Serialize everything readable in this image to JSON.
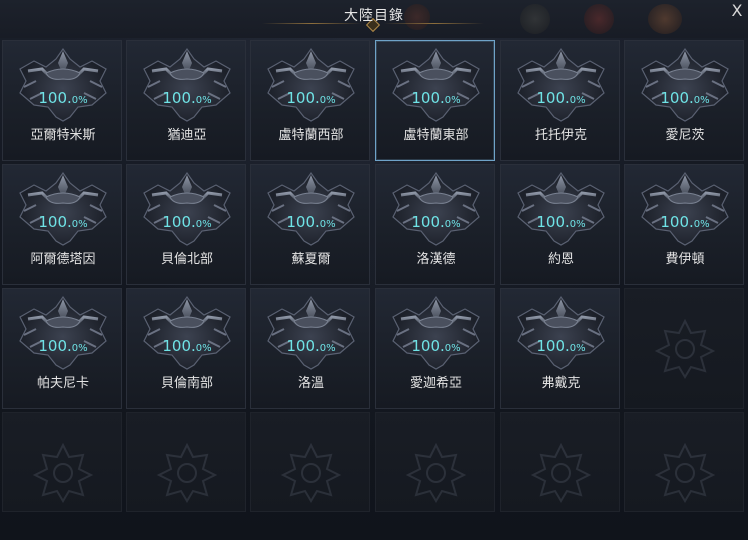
{
  "window": {
    "title": "大陸目錄",
    "close_label": "X"
  },
  "colors": {
    "accent_percent": "#6fe3e6",
    "selected_border": "#6fa3c8",
    "gold_trim": "#8c6e3c"
  },
  "continents": [
    {
      "name": "亞爾特米斯",
      "percent": "100.",
      "unit": "0%",
      "selected": false
    },
    {
      "name": "猶迪亞",
      "percent": "100.",
      "unit": "0%",
      "selected": false
    },
    {
      "name": "盧特蘭西部",
      "percent": "100.",
      "unit": "0%",
      "selected": false
    },
    {
      "name": "盧特蘭東部",
      "percent": "100.",
      "unit": "0%",
      "selected": true
    },
    {
      "name": "托托伊克",
      "percent": "100.",
      "unit": "0%",
      "selected": false
    },
    {
      "name": "愛尼茨",
      "percent": "100.",
      "unit": "0%",
      "selected": false
    },
    {
      "name": "阿爾德塔因",
      "percent": "100.",
      "unit": "0%",
      "selected": false
    },
    {
      "name": "貝倫北部",
      "percent": "100.",
      "unit": "0%",
      "selected": false
    },
    {
      "name": "蘇夏爾",
      "percent": "100.",
      "unit": "0%",
      "selected": false
    },
    {
      "name": "洛漢德",
      "percent": "100.",
      "unit": "0%",
      "selected": false
    },
    {
      "name": "約恩",
      "percent": "100.",
      "unit": "0%",
      "selected": false
    },
    {
      "name": "費伊頓",
      "percent": "100.",
      "unit": "0%",
      "selected": false
    },
    {
      "name": "帕夫尼卡",
      "percent": "100.",
      "unit": "0%",
      "selected": false
    },
    {
      "name": "貝倫南部",
      "percent": "100.",
      "unit": "0%",
      "selected": false
    },
    {
      "name": "洛溫",
      "percent": "100.",
      "unit": "0%",
      "selected": false
    },
    {
      "name": "愛迦希亞",
      "percent": "100.",
      "unit": "0%",
      "selected": false
    },
    {
      "name": "弗戴克",
      "percent": "100.",
      "unit": "0%",
      "selected": false
    }
  ],
  "empty_slot_count": 7,
  "icons": {
    "emblem": "continent-crest-icon",
    "locked": "locked-crest-icon"
  }
}
